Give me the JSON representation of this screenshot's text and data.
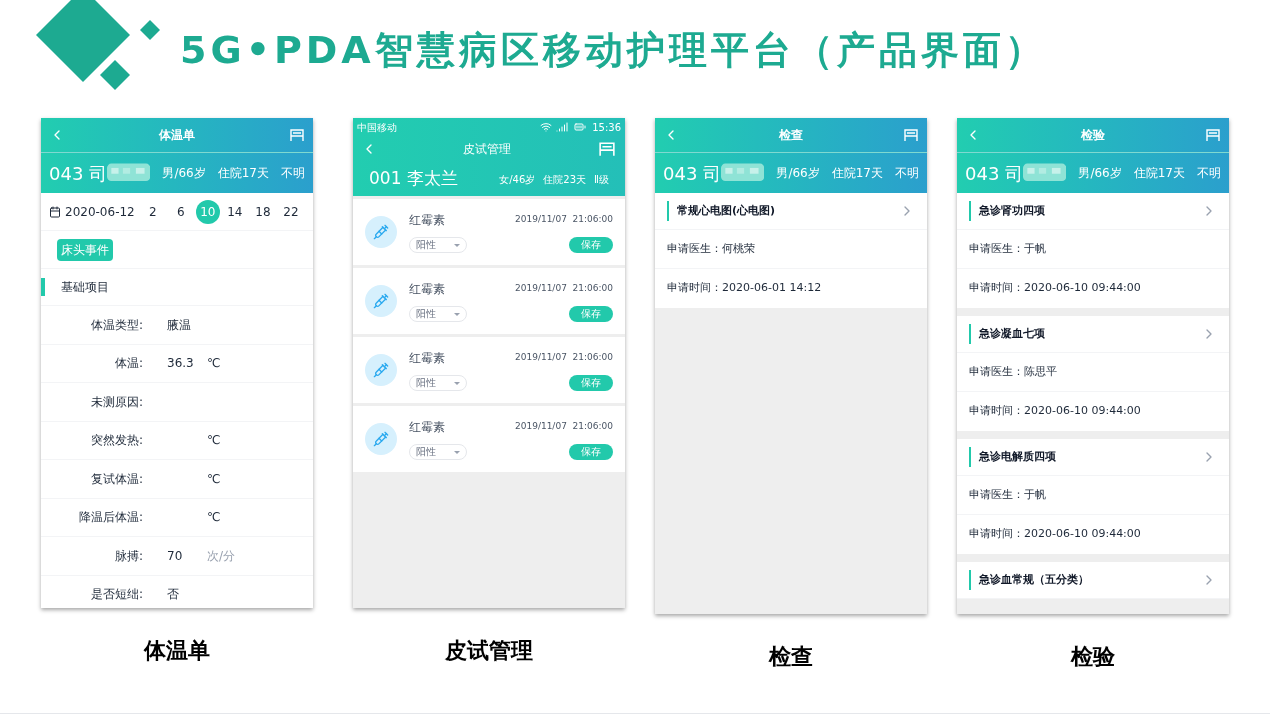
{
  "title": "5G•PDA智慧病区移动护理平台（产品界面）",
  "screens": [
    {
      "kind": "vitals",
      "caption": "体温单",
      "nav_title": "体温单",
      "patient": {
        "bed": "043 司",
        "info": [
          "男/66岁",
          "住院17天",
          "不明"
        ]
      },
      "date": "2020-06-12",
      "hours": [
        {
          "label": "2",
          "selected": false
        },
        {
          "label": "6",
          "selected": false
        },
        {
          "label": "10",
          "selected": true
        },
        {
          "label": "14",
          "selected": false
        },
        {
          "label": "18",
          "selected": false
        },
        {
          "label": "22",
          "selected": false
        }
      ],
      "event_button": "床头事件",
      "section": "基础项目",
      "fields": [
        {
          "label": "体温类型:",
          "value": "腋温"
        },
        {
          "label": "体温:",
          "value": "36.3",
          "unit": "℃",
          "unit_muted": false
        },
        {
          "label": "未测原因:"
        },
        {
          "label": "突然发热:",
          "unit": "℃",
          "unit_muted": false
        },
        {
          "label": "复试体温:",
          "unit": "℃",
          "unit_muted": false
        },
        {
          "label": "降温后体温:",
          "unit": "℃",
          "unit_muted": false
        },
        {
          "label": "脉搏:",
          "value": "70",
          "unit": "次/分",
          "unit_muted": true
        },
        {
          "label": "是否短绌:",
          "value": "否"
        }
      ]
    },
    {
      "kind": "skin_test",
      "caption": "皮试管理",
      "carrier": "中国移动",
      "time": "15:36",
      "nav_title": "皮试管理",
      "patient": {
        "bed": "001 李太兰",
        "info": [
          "女/46岁",
          "住院23天",
          "Ⅱ级"
        ]
      },
      "items": [
        {
          "drug": "红霉素",
          "time": "2019/11/07  21:06:00",
          "result": "阳性",
          "button": "保存"
        },
        {
          "drug": "红霉素",
          "time": "2019/11/07  21:06:00",
          "result": "阳性",
          "button": "保存"
        },
        {
          "drug": "红霉素",
          "time": "2019/11/07  21:06:00",
          "result": "阳性",
          "button": "保存"
        },
        {
          "drug": "红霉素",
          "time": "2019/11/07  21:06:00",
          "result": "阳性",
          "button": "保存"
        }
      ]
    },
    {
      "kind": "orders",
      "caption": "检查",
      "nav_title": "检查",
      "patient": {
        "bed": "043 司",
        "info": [
          "男/66岁",
          "住院17天",
          "不明"
        ]
      },
      "groups": [
        {
          "name": "常规心电图(心电图)",
          "doctor": "申请医生：何桃荣",
          "time": "申请时间：2020-06-01 14:12"
        }
      ]
    },
    {
      "kind": "orders",
      "caption": "检验",
      "nav_title": "检验",
      "patient": {
        "bed": "043 司",
        "info": [
          "男/66岁",
          "住院17天",
          "不明"
        ]
      },
      "groups": [
        {
          "name": "急诊肾功四项",
          "doctor": "申请医生：于帆",
          "time": "申请时间：2020-06-10 09:44:00"
        },
        {
          "name": "急诊凝血七项",
          "doctor": "申请医生：陈思平",
          "time": "申请时间：2020-06-10 09:44:00"
        },
        {
          "name": "急诊电解质四项",
          "doctor": "申请医生：于帆",
          "time": "申请时间：2020-06-10 09:44:00"
        },
        {
          "name": "急诊血常规（五分类）"
        }
      ]
    }
  ]
}
